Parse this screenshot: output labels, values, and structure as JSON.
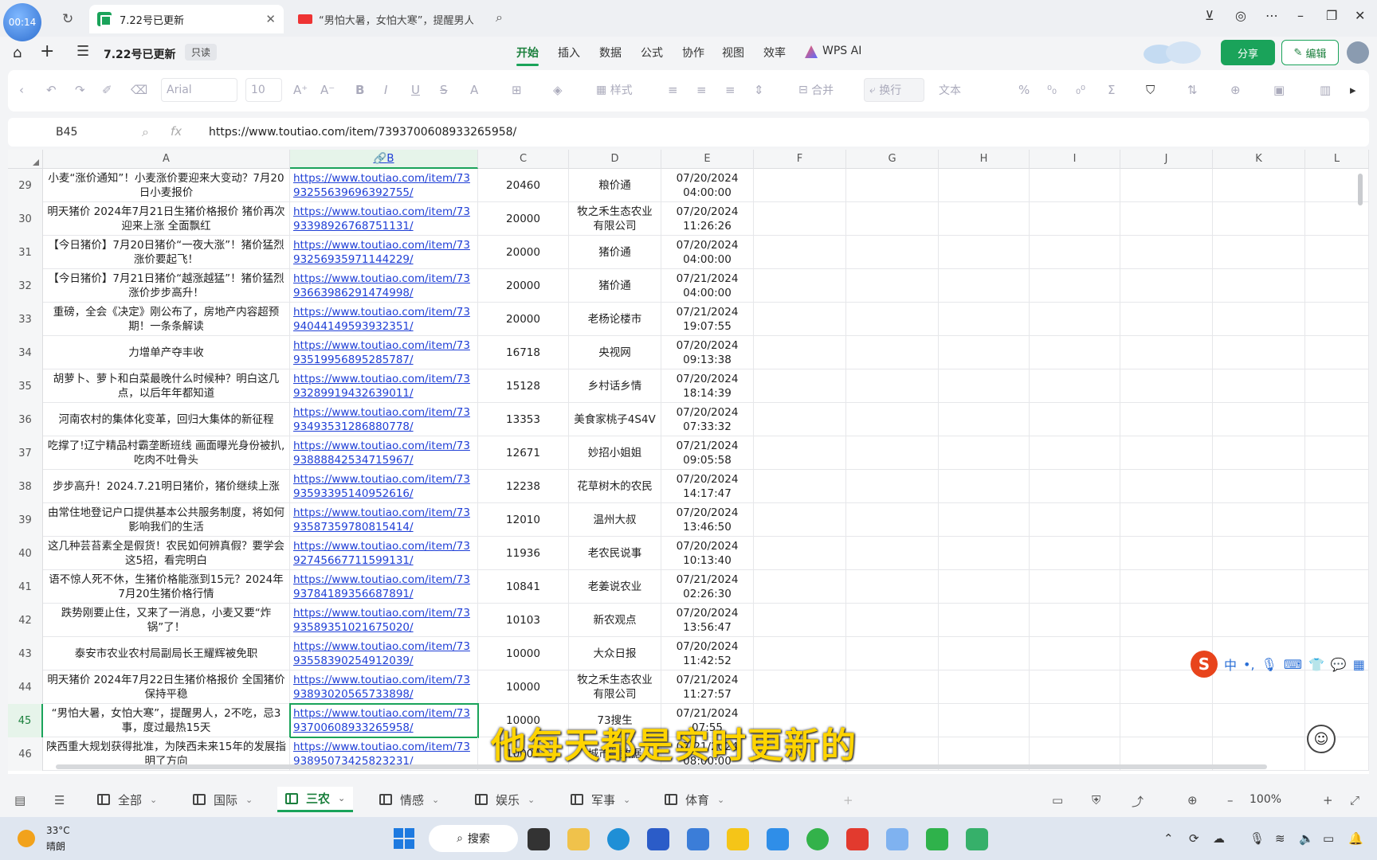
{
  "browser": {
    "time_badge": "00:14",
    "tabs": [
      {
        "title": "7.22号已更新",
        "active": true
      },
      {
        "title": "“男怕大暑，女怕大寒”，提醒男人"
      }
    ]
  },
  "menu": {
    "file_name": "7.22号已更新",
    "readonly": "只读",
    "items": [
      "开始",
      "插入",
      "数据",
      "公式",
      "协作",
      "视图",
      "效率"
    ],
    "wps_ai": "WPS AI",
    "share": "分享",
    "edit": "编辑"
  },
  "toolbar": {
    "font": "Arial",
    "size": "10",
    "style": "样式",
    "merge": "合并",
    "wrap": "换行",
    "format": "文本"
  },
  "formula_bar": {
    "cell_ref": "B45",
    "value": "https://www.toutiao.com/item/7393700608933265958/"
  },
  "columns": [
    "A",
    "B",
    "C",
    "D",
    "E",
    "F",
    "G",
    "H",
    "I",
    "J",
    "K",
    "L"
  ],
  "rows": [
    {
      "n": "29",
      "a": "小麦“涨价通知”！小麦涨价要迎来大变动？7月20日小麦报价",
      "b": "https://www.toutiao.com/item/7393255639696392755/",
      "c": "20460",
      "d": "粮价通",
      "e": "07/20/2024 04:00:00"
    },
    {
      "n": "30",
      "a": "明天猪价 2024年7月21日生猪价格报价 猪价再次迎来上涨 全面飘红",
      "b": "https://www.toutiao.com/item/7393398926768751131/",
      "c": "20000",
      "d": "牧之禾生态农业有限公司",
      "e": "07/20/2024 11:26:26"
    },
    {
      "n": "31",
      "a": "【今日猪价】7月20日猪价“一夜大涨”！猪价猛烈涨价要起飞！",
      "b": "https://www.toutiao.com/item/7393256935971144229/",
      "c": "20000",
      "d": "猪价通",
      "e": "07/20/2024 04:00:00"
    },
    {
      "n": "32",
      "a": "【今日猪价】7月21日猪价“越涨越猛”！猪价猛烈涨价步步高升！",
      "b": "https://www.toutiao.com/item/7393663986291474998/",
      "c": "20000",
      "d": "猪价通",
      "e": "07/21/2024 04:00:00"
    },
    {
      "n": "33",
      "a": "重磅，全会《决定》刚公布了，房地产内容超预期！一条条解读",
      "b": "https://www.toutiao.com/item/7394044149593932351/",
      "c": "20000",
      "d": "老杨论楼市",
      "e": "07/21/2024 19:07:55"
    },
    {
      "n": "34",
      "a": "力增单产夺丰收",
      "b": "https://www.toutiao.com/item/7393519956895285787/",
      "c": "16718",
      "d": "央视网",
      "e": "07/20/2024 09:13:38"
    },
    {
      "n": "35",
      "a": "胡萝卜、萝卜和白菜最晚什么时候种？明白这几点，以后年年都知道",
      "b": "https://www.toutiao.com/item/7393289919432639011/",
      "c": "15128",
      "d": "乡村话乡情",
      "e": "07/20/2024 18:14:39"
    },
    {
      "n": "36",
      "a": "河南农村的集体化变革，回归大集体的新征程",
      "b": "https://www.toutiao.com/item/7393493531286880778/",
      "c": "13353",
      "d": "美食家桃子4S4V",
      "e": "07/20/2024 07:33:32"
    },
    {
      "n": "37",
      "a": "吃撑了!辽宁精品村霸垄断班线 画面曝光身份被扒,吃肉不吐骨头",
      "b": "https://www.toutiao.com/item/7393888842534715967/",
      "c": "12671",
      "d": "妙招小姐姐",
      "e": "07/21/2024 09:05:58"
    },
    {
      "n": "38",
      "a": "步步高升！2024.7.21明日猪价，猪价继续上涨",
      "b": "https://www.toutiao.com/item/7393593395140952616/",
      "c": "12238",
      "d": "花草树木的农民",
      "e": "07/20/2024 14:17:47"
    },
    {
      "n": "39",
      "a": "由常住地登记户口提供基本公共服务制度，将如何影响我们的生活",
      "b": "https://www.toutiao.com/item/7393587359780815414/",
      "c": "12010",
      "d": "温州大叔",
      "e": "07/20/2024 13:46:50"
    },
    {
      "n": "40",
      "a": "这几种芸苔素全是假货！农民如何辨真假？要学会这5招，看完明白",
      "b": "https://www.toutiao.com/item/7392745667711599131/",
      "c": "11936",
      "d": "老农民说事",
      "e": "07/20/2024 10:13:40"
    },
    {
      "n": "41",
      "a": "语不惊人死不休，生猪价格能涨到15元？2024年7月20生猪价格行情",
      "b": "https://www.toutiao.com/item/7393784189356687891/",
      "c": "10841",
      "d": "老姜说农业",
      "e": "07/21/2024 02:26:30"
    },
    {
      "n": "42",
      "a": "跌势刚要止住，又来了一消息，小麦又要“炸锅”了！",
      "b": "https://www.toutiao.com/item/7393589351021675020/",
      "c": "10103",
      "d": "新农观点",
      "e": "07/20/2024 13:56:47"
    },
    {
      "n": "43",
      "a": "泰安市农业农村局副局长王耀辉被免职",
      "b": "https://www.toutiao.com/item/7393558390254912039/",
      "c": "10000",
      "d": "大众日报",
      "e": "07/20/2024 11:42:52"
    },
    {
      "n": "44",
      "a": "明天猪价 2024年7月22日生猪价格报价 全国猪价保持平稳",
      "b": "https://www.toutiao.com/item/7393893020565733898/",
      "c": "10000",
      "d": "牧之禾生态农业有限公司",
      "e": "07/21/2024 11:27:57"
    },
    {
      "n": "45",
      "a": "“男怕大暑，女怕大寒”，提醒男人，2不吃，忌3事，度过最热15天",
      "b": "https://www.toutiao.com/item/7393700608933265958/",
      "c": "10000",
      "d": "73搜生",
      "e": "07/21/2024 07:55"
    },
    {
      "n": "46",
      "a": "陕西重大规划获得批准，为陕西未来15年的发展指明了方向",
      "b": "https://www.toutiao.com/item/7393895073425823231/",
      "c": "10000",
      "d": "城市与数据",
      "e": "07/21/2024 08:00:00"
    }
  ],
  "selected_row": "45",
  "subtitle": "他每天都是实时更新的",
  "ime": {
    "logo": "S",
    "lang": "中"
  },
  "sheets": [
    {
      "name": "全部"
    },
    {
      "name": "国际"
    },
    {
      "name": "三农",
      "active": true
    },
    {
      "name": "情感"
    },
    {
      "name": "娱乐"
    },
    {
      "name": "军事"
    },
    {
      "name": "体育"
    }
  ],
  "zoom": "100%",
  "taskbar": {
    "temp": "33°C",
    "weather": "晴朗",
    "search": "搜索"
  },
  "colors": {
    "accent": "#1aa35a",
    "link": "#1f3fd6",
    "subtitle": "#ffd400"
  }
}
